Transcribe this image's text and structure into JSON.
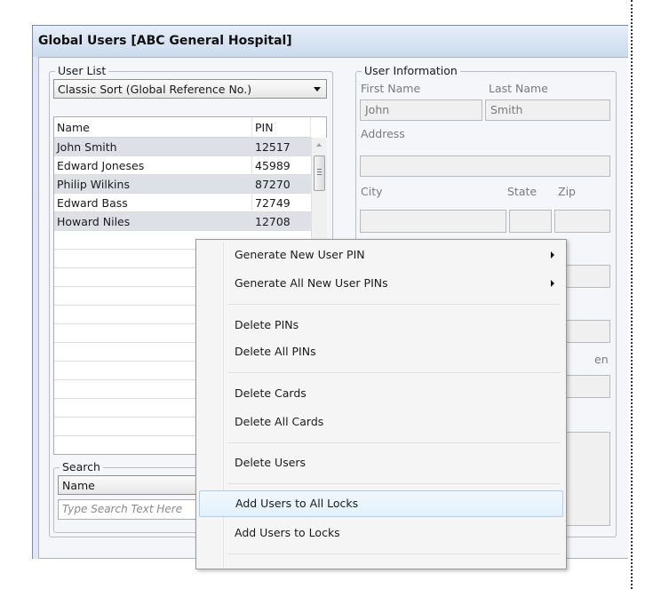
{
  "window": {
    "title": "Global Users [ABC General Hospital]"
  },
  "user_list": {
    "group_title": "User List",
    "sort_selected": "Classic Sort (Global Reference No.)",
    "columns": {
      "name": "Name",
      "pin": "PIN"
    },
    "rows": [
      {
        "name": "John Smith",
        "pin": "12517"
      },
      {
        "name": "Edward Joneses",
        "pin": "45989"
      },
      {
        "name": "Philip Wilkins",
        "pin": "87270"
      },
      {
        "name": "Edward Bass",
        "pin": "72749"
      },
      {
        "name": "Howard Niles",
        "pin": "12708"
      }
    ]
  },
  "search": {
    "group_title": "Search",
    "field_selected": "Name",
    "placeholder": "Type Search Text Here"
  },
  "user_info": {
    "group_title": "User Information",
    "first_name_label": "First Name",
    "last_name_label": "Last Name",
    "first_name_value": "John",
    "last_name_value": "Smith",
    "address_label": "Address",
    "address_value": "",
    "city_label": "City",
    "state_label": "State",
    "zip_label": "Zip",
    "partial_label": "en"
  },
  "context_menu": {
    "items": [
      {
        "label": "Generate New User PIN",
        "submenu": true
      },
      {
        "label": "Generate All New User PINs",
        "submenu": true
      },
      {
        "label": "Delete PINs"
      },
      {
        "label": "Delete All PINs"
      },
      {
        "label": "Delete Cards"
      },
      {
        "label": "Delete All Cards"
      },
      {
        "label": "Delete Users"
      },
      {
        "label": "Add Users to All Locks",
        "highlighted": true
      },
      {
        "label": "Add Users to Locks"
      }
    ]
  },
  "colors": {
    "menu_highlight": "#e2f1fb",
    "row_alt": "#dde1e7",
    "title_bar": "#cbdaee"
  }
}
